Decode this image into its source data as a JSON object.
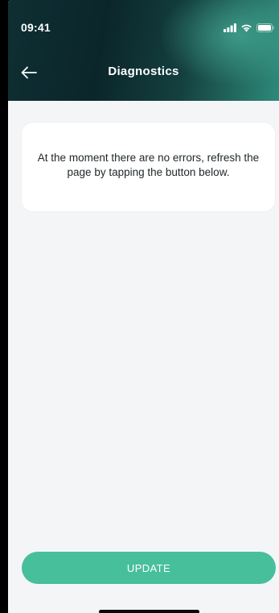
{
  "status_bar": {
    "time": "09:41",
    "icons": [
      "signal-icon",
      "wifi-icon",
      "battery-icon"
    ]
  },
  "header": {
    "title": "Diagnostics",
    "back_icon": "arrow-left-icon"
  },
  "message_card": {
    "text": "At the moment there are no errors, refresh the page by tapping the button below."
  },
  "actions": {
    "update_label": "UPDATE"
  },
  "colors": {
    "accent": "#47bf9a",
    "header_dark": "#0b262b",
    "header_light": "#2e8a7a",
    "background": "#f4f5f7",
    "card": "#ffffff",
    "text": "#1f2629"
  }
}
